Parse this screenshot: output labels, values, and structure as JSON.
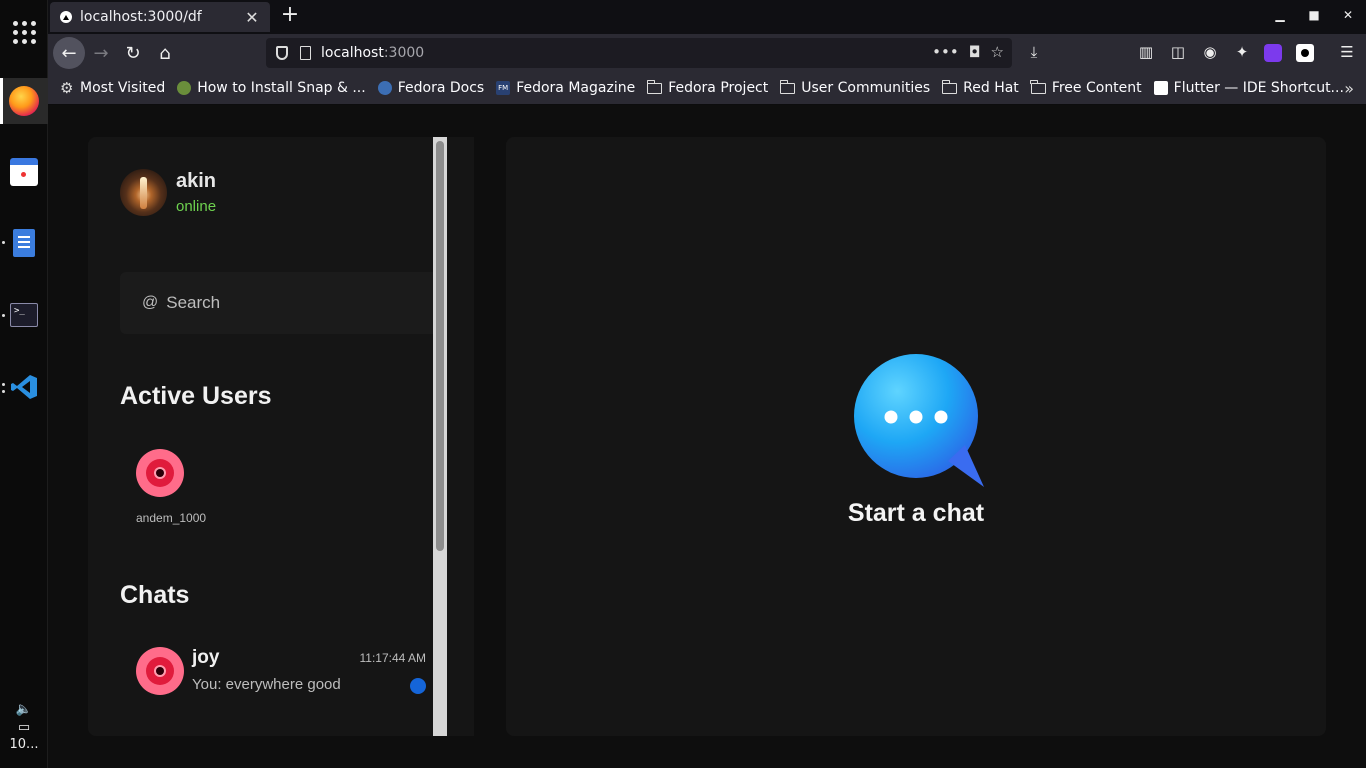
{
  "dock": {
    "apps": [
      "apps-grid-icon",
      "firefox-icon",
      "calendar-icon",
      "text-editor-icon",
      "terminal-icon",
      "vscode-icon"
    ],
    "tray_time": "10..."
  },
  "browser": {
    "tab": {
      "title": "localhost:3000/df"
    },
    "url": {
      "host": "localhost",
      "port": ":3000"
    },
    "bookmarks": [
      {
        "label": "Most Visited",
        "icon": "gear-icon"
      },
      {
        "label": "How to Install Snap & ...",
        "icon": "snap-icon"
      },
      {
        "label": "Fedora Docs",
        "icon": "fedora-icon"
      },
      {
        "label": "Fedora Magazine",
        "icon": "fm-icon"
      },
      {
        "label": "Fedora Project",
        "icon": "folder-icon"
      },
      {
        "label": "User Communities",
        "icon": "folder-icon"
      },
      {
        "label": "Red Hat",
        "icon": "folder-icon"
      },
      {
        "label": "Free Content",
        "icon": "folder-icon"
      },
      {
        "label": "Flutter — IDE Shortcut...",
        "icon": "medium-icon"
      }
    ]
  },
  "app": {
    "me": {
      "name": "akin",
      "status": "online"
    },
    "search": {
      "at": "@",
      "placeholder": "Search"
    },
    "active_users": {
      "title": "Active Users",
      "users": [
        {
          "name": "andem_1000"
        }
      ]
    },
    "chats": {
      "title": "Chats",
      "items": [
        {
          "name": "joy",
          "preview": "You: everywhere good",
          "time": "11:17:44 AM",
          "unread": true
        }
      ]
    },
    "main": {
      "empty_title": "Start a chat"
    },
    "colors": {
      "status_online": "#6ed24f",
      "unread_dot": "#1565d8",
      "bubble": "#1da1f2",
      "avatar_pink": "#ff6c8a"
    }
  }
}
